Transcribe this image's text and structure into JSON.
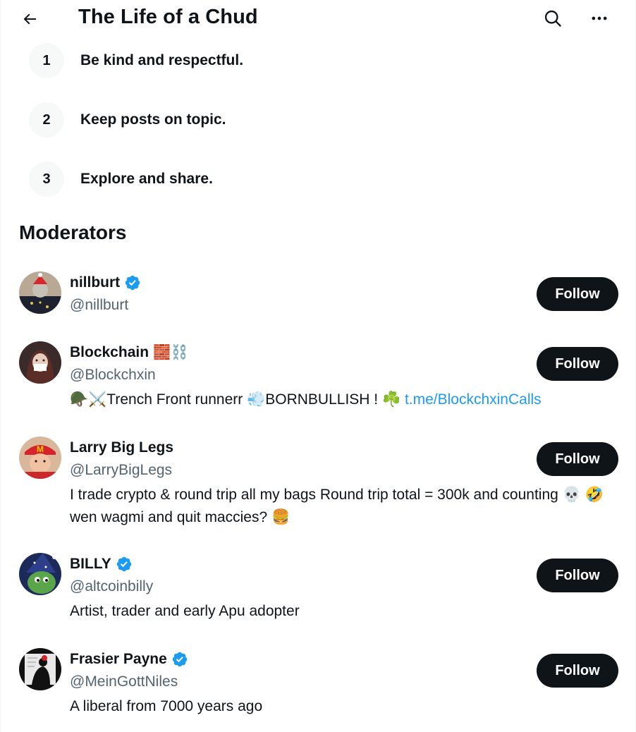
{
  "header": {
    "title": "The Life of a Chud",
    "back_icon": "arrow-left-icon",
    "search_icon": "search-icon",
    "more_icon": "more-horizontal-icon"
  },
  "rules": [
    {
      "number": "1",
      "text": "Be kind and respectful."
    },
    {
      "number": "2",
      "text": "Keep posts on topic."
    },
    {
      "number": "3",
      "text": "Explore and share."
    }
  ],
  "moderators_title": "Moderators",
  "moderators": [
    {
      "name": "nillburt",
      "verified": true,
      "handle": "@nillburt",
      "bio": "",
      "follow_label": "Follow"
    },
    {
      "name": "Blockchain",
      "name_emoji": "🧱⛓️",
      "verified": false,
      "handle": "@Blockchxin",
      "bio_prefix": "🪖⚔️Trench Front runnerr 💨BORNBULLISH ! ☘️ ",
      "bio_link": "t.me/BlockchxinCalls",
      "follow_label": "Follow"
    },
    {
      "name": "Larry Big Legs",
      "verified": false,
      "handle": "@LarryBigLegs",
      "bio": "I trade crypto & round trip all my bags Round trip total = 300k and counting 💀 🤣 wen wagmi and quit maccies? 🍔",
      "follow_label": "Follow"
    },
    {
      "name": "BILLY",
      "verified": true,
      "handle": "@altcoinbilly",
      "bio": "Artist, trader and early Apu adopter",
      "follow_label": "Follow"
    },
    {
      "name": "Frasier Payne",
      "verified": true,
      "handle": "@MeinGottNiles",
      "bio": "A liberal from 7000 years ago",
      "follow_label": "Follow"
    }
  ],
  "colors": {
    "text": "#0f1419",
    "secondary": "#536471",
    "verified": "#1d9bf0",
    "link": "#1d9bf0",
    "button_bg": "#0f1419"
  }
}
